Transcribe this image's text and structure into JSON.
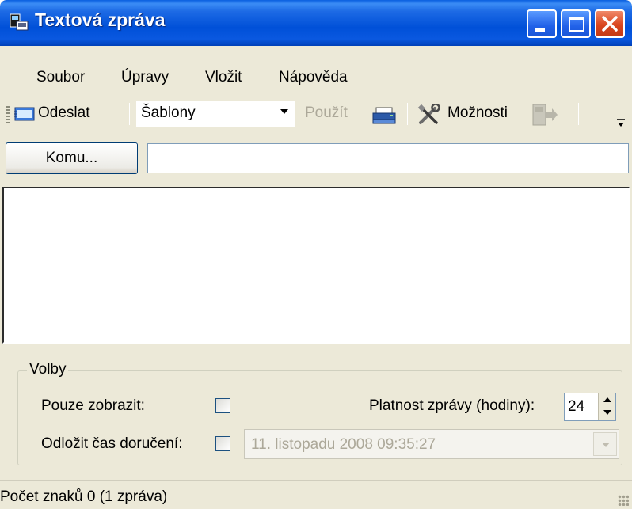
{
  "window": {
    "title": "Textová zpráva"
  },
  "menu": {
    "items": [
      "Soubor",
      "Úpravy",
      "Vložit",
      "Nápověda"
    ]
  },
  "toolbar": {
    "send_label": "Odeslat",
    "templates_value": "Šablony",
    "use_label": "Použít",
    "options_label": "Možnosti"
  },
  "recipient": {
    "button_label": "Komu...",
    "value": ""
  },
  "message": {
    "value": ""
  },
  "options": {
    "group_label": "Volby",
    "display_only_label": "Pouze zobrazit:",
    "display_only_checked": false,
    "validity_label": "Platnost zprávy (hodiny):",
    "validity_value": "24",
    "delay_label": "Odložit čas doručení:",
    "delay_checked": false,
    "delay_datetime": "11. listopadu 2008 09:35:27"
  },
  "status": {
    "text": "Počet znaků 0 (1 zpráva)"
  },
  "icons": {
    "title": "sms-app-icon",
    "send": "send-icon",
    "print": "print-icon",
    "options": "tools-icon",
    "exit": "exit-icon",
    "overflow": "toolbar-overflow-icon"
  },
  "colors": {
    "titlebar": "#0a58e0",
    "close_button": "#d9451e",
    "window_bg": "#ece9d8"
  }
}
